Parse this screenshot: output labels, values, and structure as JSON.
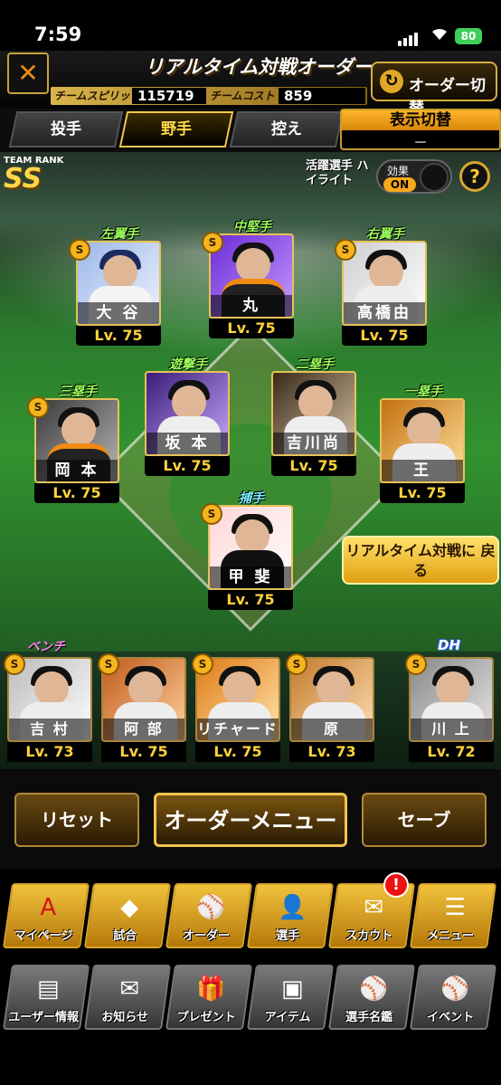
{
  "status": {
    "time": "7:59",
    "battery": "80"
  },
  "header": {
    "title": "リアルタイム対戦オーダー",
    "team_spirit_label": "チームスピリッツ",
    "team_spirit_value": "115719",
    "team_cost_label": "チームコスト",
    "team_cost_value": "859",
    "order_switch_label": "オーダー切替"
  },
  "tabs": [
    {
      "label": "投手"
    },
    {
      "label": "野手"
    },
    {
      "label": "控え"
    }
  ],
  "active_tab": "野手",
  "display_switch": {
    "label": "表示切替",
    "value": "－"
  },
  "team_rank": {
    "label": "TEAM RANK",
    "value": "SS"
  },
  "highlight": {
    "label": "活躍選手 ハイライト",
    "effect_label": "効果",
    "effect_state": "ON"
  },
  "help": "?",
  "fielders": [
    {
      "position": "左翼手",
      "name": "大 谷",
      "level": "Lv. 75",
      "badge": "S"
    },
    {
      "position": "中堅手",
      "name": "丸",
      "level": "Lv. 75",
      "badge": "S"
    },
    {
      "position": "右翼手",
      "name": "高橋由",
      "level": "Lv. 75",
      "badge": "S"
    },
    {
      "position": "遊撃手",
      "name": "坂 本",
      "level": "Lv. 75",
      "badge": ""
    },
    {
      "position": "二塁手",
      "name": "吉川尚",
      "level": "Lv. 75",
      "badge": ""
    },
    {
      "position": "三塁手",
      "name": "岡 本",
      "level": "Lv. 75",
      "badge": "S"
    },
    {
      "position": "一塁手",
      "name": "王",
      "level": "Lv. 75",
      "badge": ""
    },
    {
      "position": "捕手",
      "name": "甲 斐",
      "level": "Lv. 75",
      "badge": "S"
    }
  ],
  "return_button": "リアルタイム対戦に 戻る",
  "bench_label": "ベンチ",
  "dh_label": "DH",
  "bench": [
    {
      "name": "吉 村",
      "level": "Lv. 73",
      "badge": "S"
    },
    {
      "name": "阿 部",
      "level": "Lv. 75",
      "badge": "S"
    },
    {
      "name": "リチャード",
      "level": "Lv. 75",
      "badge": "S"
    },
    {
      "name": "原",
      "level": "Lv. 73",
      "badge": "S"
    },
    {
      "name": "川 上",
      "level": "Lv. 72",
      "badge": "S"
    }
  ],
  "actions": {
    "reset": "リセット",
    "order_menu": "オーダーメニュー",
    "save": "セーブ"
  },
  "nav_primary": [
    {
      "label": "マイページ",
      "icon": "A"
    },
    {
      "label": "試合",
      "icon": "◆"
    },
    {
      "label": "オーダー",
      "icon": "⚾"
    },
    {
      "label": "選手",
      "icon": "👤"
    },
    {
      "label": "スカウト",
      "icon": "✉"
    },
    {
      "label": "メニュー",
      "icon": "☰"
    }
  ],
  "nav_notification": "!",
  "nav_secondary": [
    {
      "label": "ユーザー情報",
      "icon": "▤"
    },
    {
      "label": "お知らせ",
      "icon": "✉"
    },
    {
      "label": "プレゼント",
      "icon": "🎁"
    },
    {
      "label": "アイテム",
      "icon": "▣"
    },
    {
      "label": "選手名鑑",
      "icon": "⚾"
    },
    {
      "label": "イベント",
      "icon": "⚾"
    }
  ]
}
